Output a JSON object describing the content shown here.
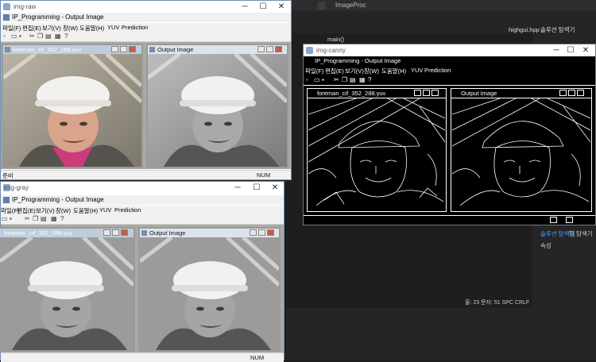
{
  "ide": {
    "title": "ImageProc",
    "tab": "highgui.hpp",
    "function": "main()",
    "solution_header": "솔루션 탐색기",
    "solution_tab": "솔루션 탐색기",
    "team_tab": "팀 탐색기",
    "properties_label": "속성",
    "status": "줄: 23    문자: 51    SPC    CRLF"
  },
  "windows": {
    "raw": {
      "window_title": "img-raw",
      "app_title": "IP_Programming - Output Image",
      "menus": [
        "파일(F)",
        "편집(E)",
        "보기(V)",
        "창(W)",
        "도움말(H)",
        "YUV",
        "Prediction"
      ],
      "child_left_title": "foreman_cif_352_288.yuv",
      "child_right_title": "Output Image",
      "status_left": "준비",
      "status_right": "NUM"
    },
    "canny": {
      "window_title": "img-canny",
      "app_title": "IP_Programming - Output Image",
      "menus": [
        "파일(F)",
        "편집(E)",
        "보기(V)",
        "창(W)",
        "도움말(H)",
        "YUV",
        "Prediction"
      ],
      "child_left_title": "foreman_cif_352_288.yuv",
      "child_right_title": "Output Image"
    },
    "gray": {
      "window_title": "img-gray",
      "app_title": "IP_Programming - Output Image",
      "menus": [
        "파일(F)",
        "편집(E)",
        "보기(V)",
        "창(W)",
        "도움말(H)",
        "YUV",
        "Prediction"
      ],
      "child_left_title": "foreman_cif_352_288.yuv",
      "child_right_title": "Output Image",
      "status_right": "NUM"
    }
  },
  "icons": [
    "minimize-icon",
    "maximize-icon",
    "close-icon",
    "new-file-icon",
    "open-folder-icon",
    "save-icon",
    "cut-icon",
    "copy-icon",
    "paste-icon",
    "print-icon",
    "help-icon"
  ],
  "colors": {
    "ide_bg": "#1e1e1e",
    "window_border": "#6b8fb5",
    "mdi_bg": "#aba9a4",
    "close_red": "#c85a4b"
  }
}
